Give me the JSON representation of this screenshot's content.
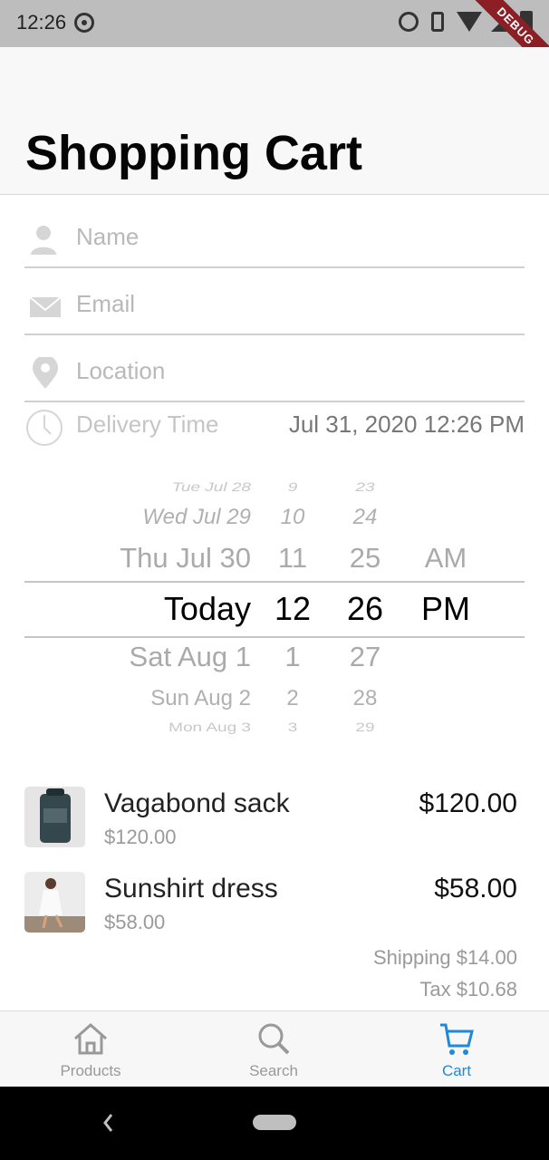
{
  "status_bar": {
    "time": "12:26",
    "debug_badge": "DEBUG"
  },
  "header": {
    "title": "Shopping Cart"
  },
  "form": {
    "name_placeholder": "Name",
    "email_placeholder": "Email",
    "location_placeholder": "Location",
    "delivery_label": "Delivery Time",
    "delivery_value": "Jul 31, 2020 12:26 PM"
  },
  "picker": {
    "rows": [
      {
        "date": "Tue Jul 28",
        "hour": "9",
        "minute": "23",
        "ampm": ""
      },
      {
        "date": "Wed Jul 29",
        "hour": "10",
        "minute": "24",
        "ampm": ""
      },
      {
        "date": "Thu Jul 30",
        "hour": "11",
        "minute": "25",
        "ampm": "AM"
      },
      {
        "date": "Today",
        "hour": "12",
        "minute": "26",
        "ampm": "PM"
      },
      {
        "date": "Sat Aug 1",
        "hour": "1",
        "minute": "27",
        "ampm": ""
      },
      {
        "date": "Sun Aug 2",
        "hour": "2",
        "minute": "28",
        "ampm": ""
      },
      {
        "date": "Mon Aug 3",
        "hour": "3",
        "minute": "29",
        "ampm": ""
      }
    ]
  },
  "cart": {
    "items": [
      {
        "name": "Vagabond sack",
        "unit_price": "$120.00",
        "total": "$120.00"
      },
      {
        "name": "Sunshirt dress",
        "unit_price": "$58.00",
        "total": "$58.00"
      }
    ],
    "shipping": "Shipping $14.00",
    "tax": "Tax $10.68"
  },
  "bottom_nav": {
    "items": [
      {
        "label": "Products",
        "icon": "home-icon"
      },
      {
        "label": "Search",
        "icon": "search-icon"
      },
      {
        "label": "Cart",
        "icon": "cart-icon"
      }
    ],
    "active_color": "#2289d8"
  }
}
